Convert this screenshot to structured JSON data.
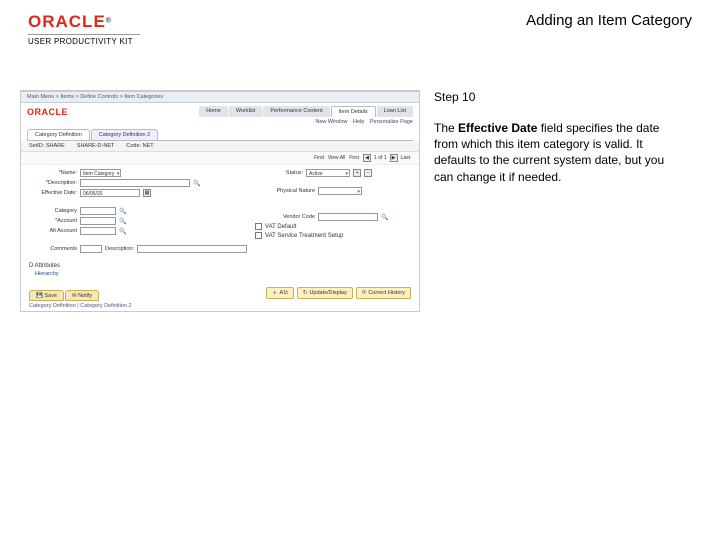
{
  "header": {
    "brand": "ORACLE",
    "subtitle": "USER PRODUCTIVITY KIT",
    "page_title": "Adding an Item Category"
  },
  "instruction": {
    "step_label": "Step 10",
    "text_prefix": "The ",
    "bold": "Effective Date",
    "text_suffix": " field specifies the date from which this item category is valid. It defaults to the current system date, but you can change it if needed."
  },
  "app": {
    "logo": "ORACLE",
    "top_tabs": [
      "Home",
      "Worklist",
      "Performance Content",
      "Item Details",
      "Loan List"
    ],
    "top_tabs_selected": 3,
    "breadcrumb": "Main Menu  >  Items  >  Define Controls  >  Item Categories",
    "links": [
      "New Window",
      "Help",
      "Personalize Page"
    ],
    "subtabs": [
      "Category Definition",
      "Category Definition 2"
    ],
    "subtab_selected": 0,
    "info_row": {
      "setid_label": "SetID:",
      "setid_value": "SHARE",
      "category_label": "SHARE-D-NET",
      "code_label": "Code:",
      "code_value": "NET"
    },
    "toolbar": {
      "find_label": "Find",
      "view_label": "View All",
      "first_label": "First",
      "counter": "1 of 1",
      "last_label": "Last"
    },
    "left_fields": {
      "name": {
        "label": "Name:",
        "value": "Item Category"
      },
      "description": {
        "label": "Description:",
        "value": ""
      },
      "eff_date": {
        "label": "Effective Date:",
        "value": "06/05/20"
      },
      "category": {
        "label": "Category"
      },
      "account": {
        "label": "Account"
      },
      "alt_account": {
        "label": "Alt Account"
      },
      "comments": {
        "label": "Comments"
      },
      "desc2": {
        "label": "Description:"
      }
    },
    "right_fields": {
      "status": {
        "label": "Status:",
        "value": "Active"
      },
      "physical_nature": {
        "label": "Physical Nature"
      },
      "vendor_code": {
        "label": "Vendor Code"
      },
      "vat_default": {
        "label": "VAT Default"
      },
      "vat_service": {
        "label": "VAT Service Treatment Setup"
      }
    },
    "d_attributes_label": "D Attributes",
    "hierarchy_label": "Hierarchy",
    "bottom_tabs": [
      "Save",
      "Notify"
    ],
    "bottom_bar": {
      "add": "A1t",
      "update": "Update/Display",
      "correct": "Correct History"
    },
    "footer_breadcrumb": "Category Definition | Category Definition 2"
  }
}
